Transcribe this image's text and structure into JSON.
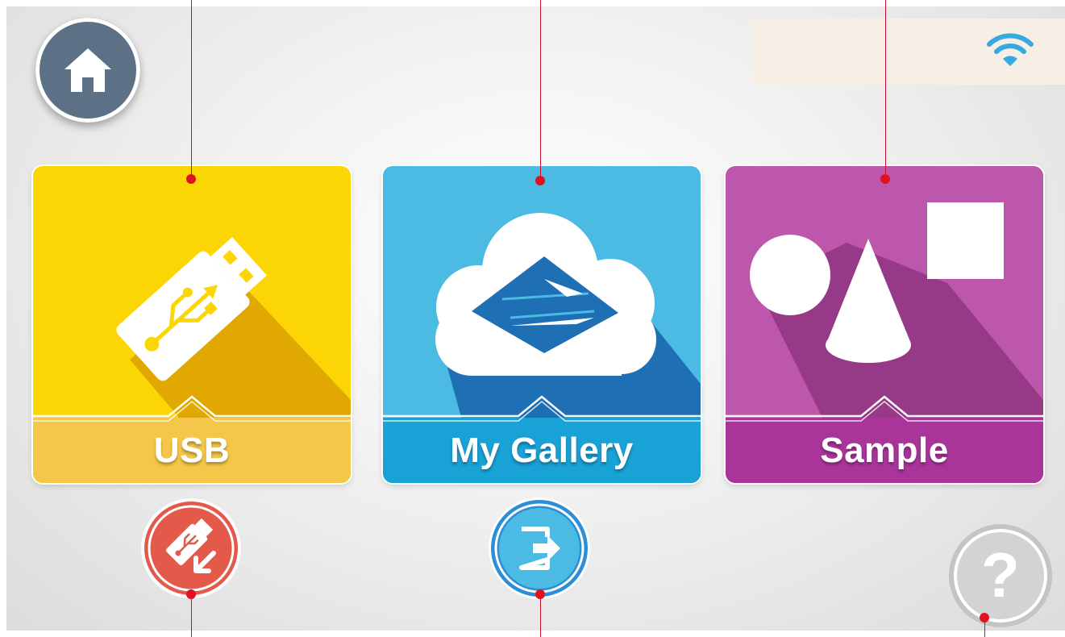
{
  "header": {
    "home_icon": "home-icon",
    "status_icon": "wifi-icon"
  },
  "tiles": [
    {
      "label": "USB",
      "icon": "usb-drive-icon",
      "color": "#fcd505",
      "band_color": "#f4c74a"
    },
    {
      "label": "My Gallery",
      "icon": "cloud-gallery-icon",
      "color": "#4bbbe4",
      "band_color": "#19a2d6"
    },
    {
      "label": "Sample",
      "icon": "shapes-icon",
      "color": "#bd57ac",
      "band_color": "#a9359b"
    }
  ],
  "actions": {
    "usb_import_icon": "usb-import-icon",
    "export_icon": "export-icon",
    "help_icon": "help-icon",
    "help_glyph": "?"
  },
  "colors": {
    "home": "#5c7086",
    "usb_import": "#e35a4b",
    "export": "#2c8ed6",
    "help": "#cfcfcf",
    "callout": "#e1121f"
  }
}
